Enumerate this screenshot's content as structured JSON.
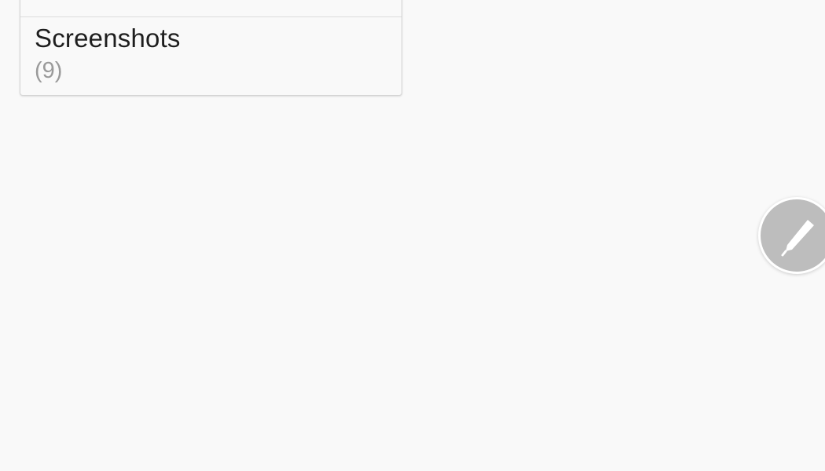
{
  "album_list": {
    "items": [
      {
        "title": "Screenshots",
        "count": "(9)"
      }
    ]
  },
  "fab": {
    "icon": "pencil-icon"
  },
  "colors": {
    "background": "#f9f9f9",
    "fab": "#bdbdbd",
    "title_text": "#1e1e1e",
    "count_text": "#9a9a9a"
  }
}
